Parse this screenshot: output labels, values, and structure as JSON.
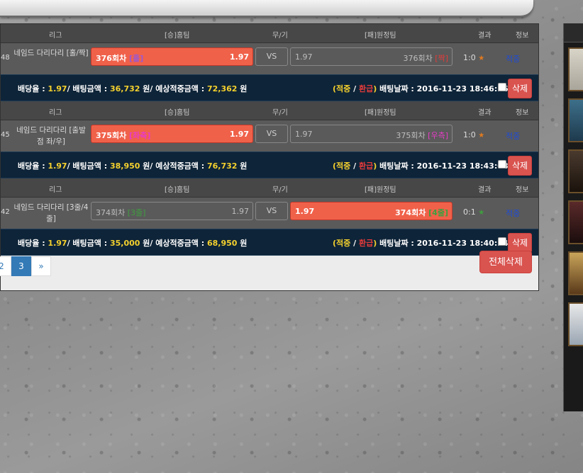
{
  "headers": {
    "league": "리그",
    "home": "[승]홈팀",
    "draw": "무/기",
    "away": "[패]원정팀",
    "result": "결과",
    "info": "정보"
  },
  "bets": [
    {
      "idx": "48",
      "league": "네임드 다리다리 [홀/짝]",
      "home_name": "376회차",
      "home_tag": "[홀]",
      "home_tag_color": "#9b59d0",
      "home_odds": "1.97",
      "vs": "VS",
      "away_odds": "1.97",
      "away_name": "376회차",
      "away_tag": "[짝]",
      "away_tag_color": "#e33b3b",
      "selected": "home",
      "score": "1:0",
      "score_icon": "star-icon",
      "score_icon_color": "#e07a20",
      "info": "적중",
      "summary": {
        "odds_label": "배당율 : ",
        "odds": "1.97",
        "amount_label": "/ 배팅금액 : ",
        "amount": "36,732",
        "unit1": " 원",
        "expected_label": "/ 예상적중금액 : ",
        "expected": "72,362",
        "unit2": " 원",
        "status_open": "(",
        "status_hit": "적중",
        "status_sep": " / ",
        "status_refund": "환급",
        "status_close": ")",
        "date_label": " 배팅날짜 : ",
        "date": "2016-11-23 18:46:36",
        "delete": "삭제"
      }
    },
    {
      "idx": "45",
      "league": "네임드 다리다리 [출발점 좌/우]",
      "home_name": "375회차",
      "home_tag": "[좌측]",
      "home_tag_color": "#e83bc8",
      "home_odds": "1.97",
      "vs": "VS",
      "away_odds": "1.97",
      "away_name": "375회차",
      "away_tag": "[우측]",
      "away_tag_color": "#e83bc8",
      "selected": "home",
      "score": "1:0",
      "score_icon": "star-icon",
      "score_icon_color": "#e07a20",
      "info": "적중",
      "summary": {
        "odds_label": "배당율 : ",
        "odds": "1.97",
        "amount_label": "/ 배팅금액 : ",
        "amount": "38,950",
        "unit1": " 원",
        "expected_label": "/ 예상적중금액 : ",
        "expected": "76,732",
        "unit2": " 원",
        "status_open": "(",
        "status_hit": "적중",
        "status_sep": " / ",
        "status_refund": "환급",
        "status_close": ")",
        "date_label": " 배팅날짜 : ",
        "date": "2016-11-23 18:43:08",
        "delete": "삭제"
      }
    },
    {
      "idx": "42",
      "league": "네임드 다리다리 [3줄/4줄]",
      "home_name": "374회차",
      "home_tag": "[3줄]",
      "home_tag_color": "#3f9f3f",
      "home_odds": "1.97",
      "vs": "VS",
      "away_odds": "1.97",
      "away_name": "374회차",
      "away_tag": "[4줄]",
      "away_tag_color": "#3f9f3f",
      "selected": "away",
      "score": "0:1",
      "score_icon": "star-icon",
      "score_icon_color": "#3f9f3f",
      "info": "적중",
      "summary": {
        "odds_label": "배당율 : ",
        "odds": "1.97",
        "amount_label": "/ 배팅금액 : ",
        "amount": "35,000",
        "unit1": " 원",
        "expected_label": "/ 예상적중금액 : ",
        "expected": "68,950",
        "unit2": " 원",
        "status_open": "(",
        "status_hit": "적중",
        "status_sep": " / ",
        "status_refund": "환급",
        "status_close": ")",
        "date_label": " 배팅날짜 : ",
        "date": "2016-11-23 18:40:24",
        "delete": "삭제"
      }
    }
  ],
  "pagination": {
    "pages": [
      "2",
      "3"
    ],
    "active": "3",
    "next": "»"
  },
  "delete_all": "전체삭제"
}
